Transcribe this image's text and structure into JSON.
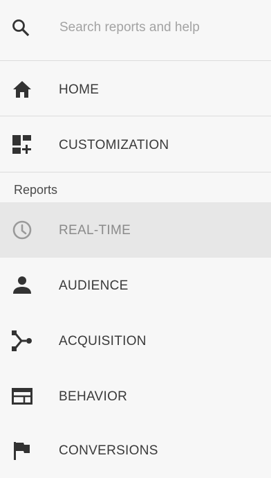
{
  "search": {
    "placeholder": "Search reports and help",
    "icon": "search-icon"
  },
  "top_items": [
    {
      "label": "HOME",
      "icon": "home-icon"
    },
    {
      "label": "CUSTOMIZATION",
      "icon": "dashboard-add-icon"
    }
  ],
  "reports_section": {
    "title": "Reports",
    "items": [
      {
        "label": "REAL-TIME",
        "icon": "clock-icon",
        "active": true
      },
      {
        "label": "AUDIENCE",
        "icon": "person-icon"
      },
      {
        "label": "ACQUISITION",
        "icon": "fork-icon"
      },
      {
        "label": "BEHAVIOR",
        "icon": "browser-window-icon"
      },
      {
        "label": "CONVERSIONS",
        "icon": "flag-icon"
      }
    ]
  },
  "colors": {
    "background": "#f7f7f7",
    "active_background": "#e7e7e7",
    "icon": "#333333",
    "active_icon": "#9a9a9a",
    "divider": "#dcdcdc"
  }
}
